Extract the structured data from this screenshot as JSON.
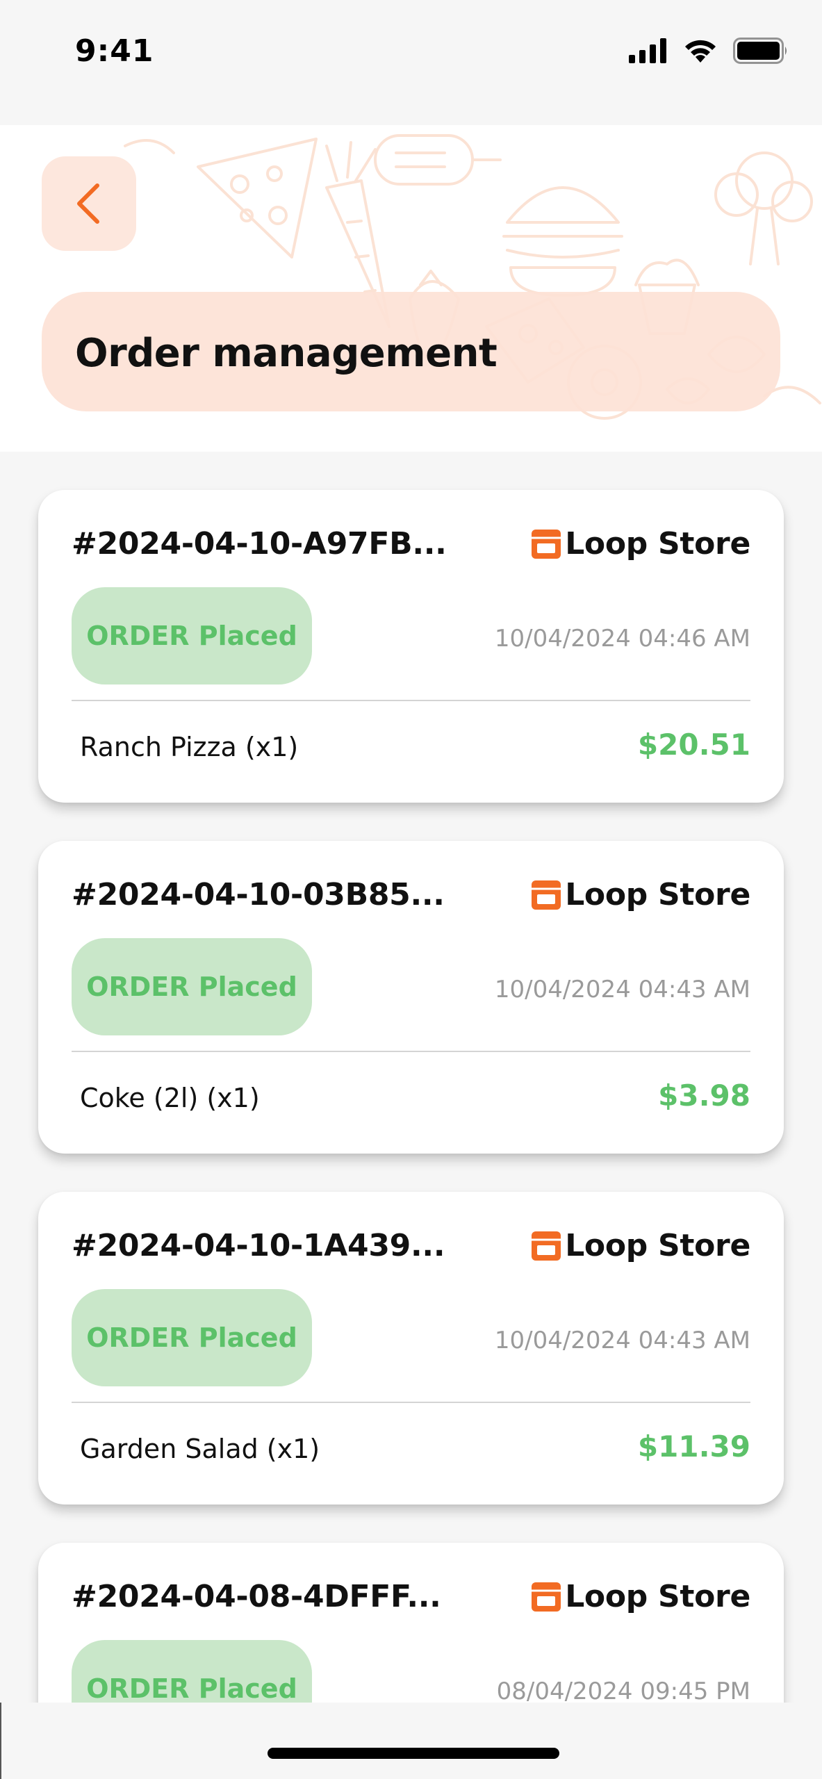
{
  "status_bar": {
    "time": "9:41",
    "icons": [
      "signal-icon",
      "wifi-icon",
      "battery-icon"
    ]
  },
  "header": {
    "title": "Order management",
    "back_icon": "chevron-left-icon"
  },
  "colors": {
    "accent": "#f26b23",
    "status_green": "#5cc169",
    "status_badge_bg": "#c9e7c9",
    "title_banner_bg": "#fde2d6"
  },
  "orders": [
    {
      "id": "#2024-04-10-A97FB...",
      "store": "Loop Store",
      "status": "ORDER Placed",
      "date": "10/04/2024 04:46 AM",
      "item": "Ranch Pizza (x1)",
      "price": "$20.51"
    },
    {
      "id": "#2024-04-10-03B85...",
      "store": "Loop Store",
      "status": "ORDER Placed",
      "date": "10/04/2024 04:43 AM",
      "item": "Coke (2l) (x1)",
      "price": "$3.98"
    },
    {
      "id": "#2024-04-10-1A439...",
      "store": "Loop Store",
      "status": "ORDER Placed",
      "date": "10/04/2024 04:43 AM",
      "item": "Garden Salad (x1)",
      "price": "$11.39"
    },
    {
      "id": "#2024-04-08-4DFFF...",
      "store": "Loop Store",
      "status": "ORDER Placed",
      "date": "08/04/2024 09:45 PM",
      "item": "",
      "price": ""
    }
  ]
}
